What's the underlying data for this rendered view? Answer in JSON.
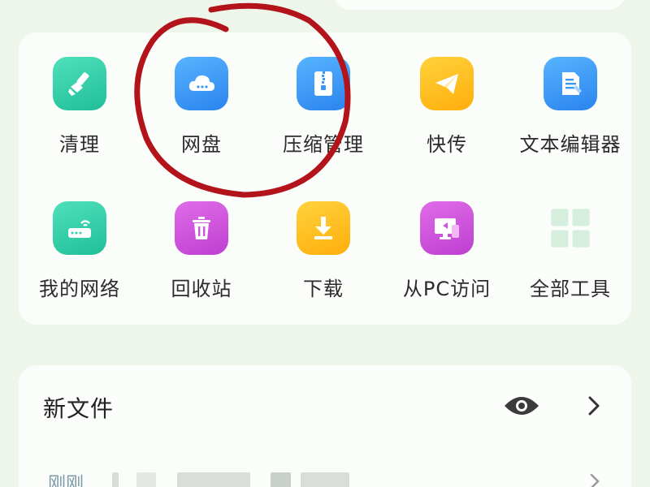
{
  "tools": [
    {
      "label": "清理",
      "icon": "brush-icon"
    },
    {
      "label": "网盘",
      "icon": "cloud-icon"
    },
    {
      "label": "压缩管理",
      "icon": "zip-icon"
    },
    {
      "label": "快传",
      "icon": "paper-plane-icon"
    },
    {
      "label": "文本编辑器",
      "icon": "document-icon"
    },
    {
      "label": "我的网络",
      "icon": "router-icon"
    },
    {
      "label": "回收站",
      "icon": "trash-icon"
    },
    {
      "label": "下载",
      "icon": "download-icon"
    },
    {
      "label": "从PC访问",
      "icon": "monitor-icon"
    },
    {
      "label": "全部工具",
      "icon": "grid-icon"
    }
  ],
  "new_files": {
    "title": "新文件",
    "time_label": "刚刚"
  },
  "colors": {
    "green": "#2fd1a8",
    "blue": "#3a99f7",
    "yellow": "#ffc21f",
    "purple": "#d055de",
    "annotation_red": "#b3141b"
  }
}
